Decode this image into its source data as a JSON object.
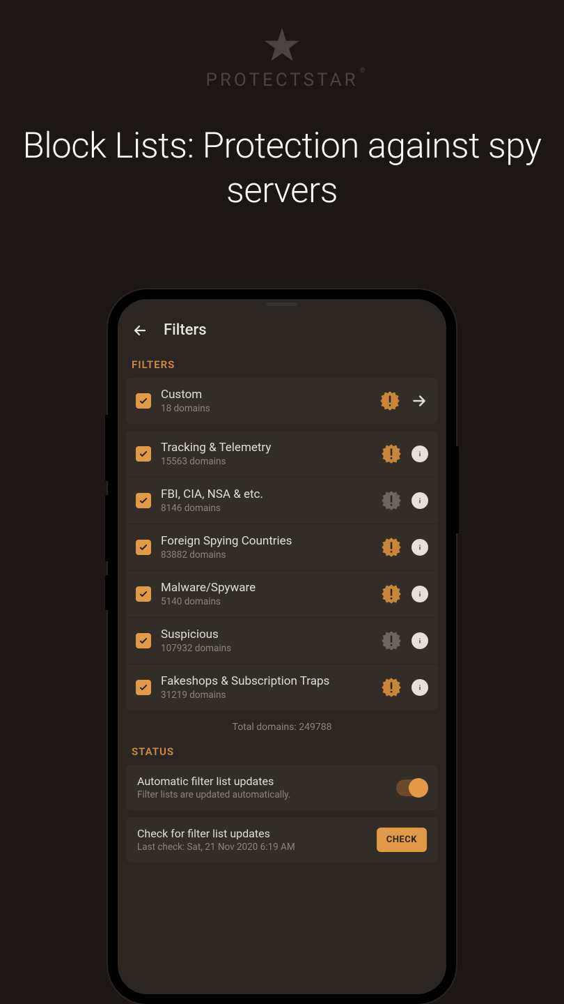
{
  "brand": {
    "name": "PROTECTSTAR"
  },
  "headline": "Block Lists: Protection against spy servers",
  "app": {
    "title": "Filters",
    "section_filters": "FILTERS",
    "section_status": "STATUS",
    "total_prefix": "Total domains: ",
    "total_count": "249788"
  },
  "filters": [
    {
      "name": "Custom",
      "domains": "18 domains",
      "badge": "orange",
      "nav": true,
      "info": false
    },
    {
      "name": "Tracking & Telemetry",
      "domains": "15563 domains",
      "badge": "orange",
      "nav": false,
      "info": true
    },
    {
      "name": "FBI, CIA, NSA & etc.",
      "domains": "8146 domains",
      "badge": "gray",
      "nav": false,
      "info": true
    },
    {
      "name": "Foreign Spying Countries",
      "domains": "83882 domains",
      "badge": "orange",
      "nav": false,
      "info": true
    },
    {
      "name": "Malware/Spyware",
      "domains": "5140 domains",
      "badge": "orange",
      "nav": false,
      "info": true
    },
    {
      "name": "Suspicious",
      "domains": "107932 domains",
      "badge": "gray",
      "nav": false,
      "info": true
    },
    {
      "name": "Fakeshops & Subscription Traps",
      "domains": "31219 domains",
      "badge": "orange",
      "nav": false,
      "info": true
    }
  ],
  "status": {
    "auto": {
      "title": "Automatic filter list updates",
      "sub": "Filter lists are updated automatically."
    },
    "check": {
      "title": "Check for filter list updates",
      "sub": "Last check: Sat, 21 Nov 2020 6:19 AM",
      "button": "CHECK"
    }
  }
}
